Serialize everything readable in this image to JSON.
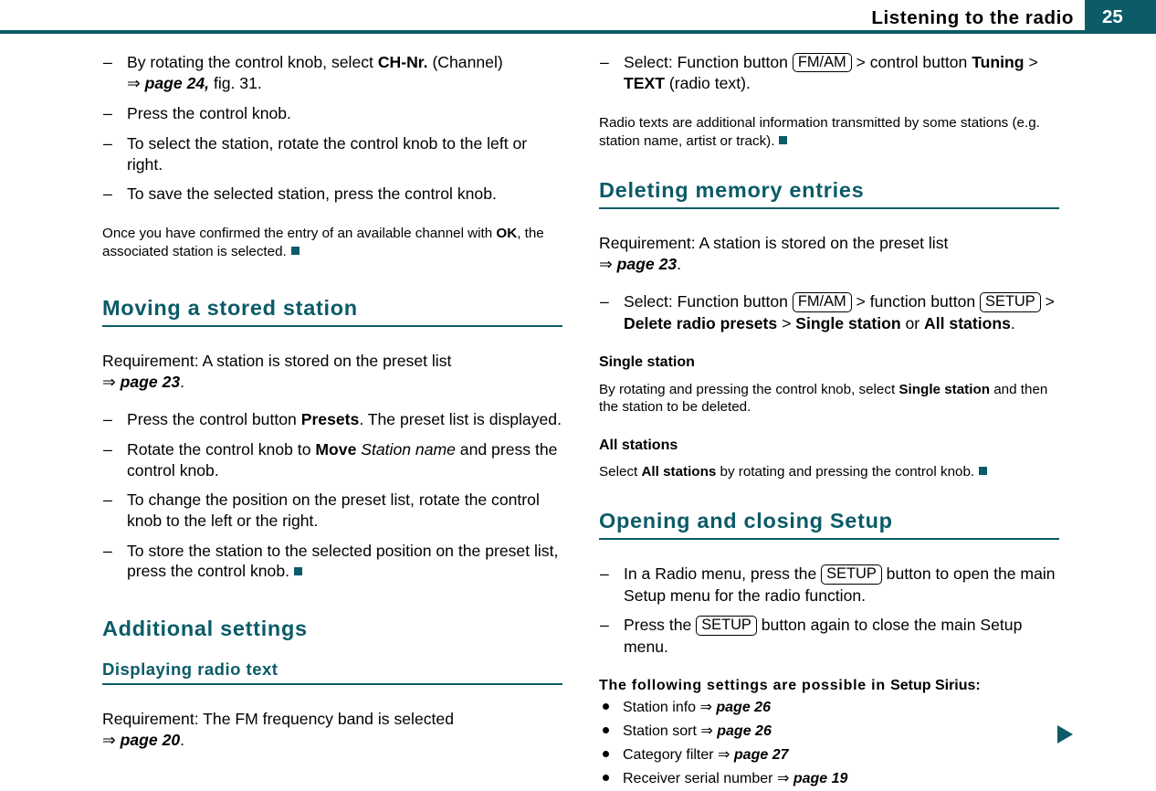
{
  "header": {
    "title": "Listening to the radio",
    "page_number": "25",
    "accent_color": "#0b5b68"
  },
  "arrow_glyph": "⇒",
  "continue_arrow_name": "continue-arrow",
  "left_column": {
    "steps_1": [
      {
        "prefix": "By rotating the control knob, select ",
        "bold": "CH-Nr.",
        "middle": " (Channel)",
        "ref_arrow": "⇒",
        "ref": "page 24,",
        "suffix": " fig. 31."
      },
      {
        "text": "Press the control knob."
      },
      {
        "text": "To select the station, rotate the control knob to the left or right."
      },
      {
        "text": "To save the selected station, press the control knob."
      }
    ],
    "note_1": {
      "prefix": "Once you have confirmed the entry of an available channel with ",
      "bold": "OK",
      "suffix": ", the associated station is selected."
    },
    "heading_moving": "Moving a stored station",
    "requirement_moving": {
      "text": "Requirement: A station is stored on the preset list",
      "ref_arrow": "⇒",
      "ref": "page 23",
      "suffix": "."
    },
    "steps_2": [
      {
        "prefix": "Press the control button ",
        "bold": "Presets",
        "suffix": ". The preset list is displayed."
      },
      {
        "prefix": "Rotate the control knob to ",
        "bold": "Move",
        "italic": " Station name",
        "suffix": " and press the control knob."
      },
      {
        "text": "To change the position on the preset list, rotate the control knob to the left or the right."
      },
      {
        "text": "To store the station to the selected position on the preset list, press the control knob.",
        "end_square": true
      }
    ],
    "heading_additional": "Additional settings",
    "heading_displaying": "Displaying radio text",
    "requirement_displaying": {
      "text": "Requirement: The FM frequency band is selected",
      "ref_arrow": "⇒",
      "ref": "page 20",
      "suffix": "."
    }
  },
  "right_column": {
    "step_radiotext": {
      "prefix": "Select: Function button ",
      "key1": "FM/AM",
      "middle": " > control button ",
      "bold1": "Tuning",
      "middle2": " > ",
      "bold2": "TEXT",
      "suffix": " (radio text)."
    },
    "note_radiotext": {
      "text": "Radio texts are additional information transmitted by some stations (e.g. station name, artist or track)."
    },
    "heading_deleting": "Deleting memory entries",
    "requirement_deleting": {
      "text": "Requirement: A station is stored on the preset list",
      "ref_arrow": "⇒",
      "ref": "page 23",
      "suffix": "."
    },
    "step_deleting": {
      "prefix": "Select: Function button ",
      "key1": "FM/AM",
      "middle": " > function button ",
      "key2": "SETUP",
      "middle2": " > ",
      "bold1": "Delete radio presets",
      "middle3": " > ",
      "bold2": "Single station",
      "middle4": " or ",
      "bold3": "All stations",
      "suffix": "."
    },
    "heading_single_station": "Single station",
    "text_single_station": {
      "prefix": "By rotating and pressing the control knob, select ",
      "bold": "Single station",
      "suffix": " and then the station to be deleted."
    },
    "heading_all_stations": "All stations",
    "text_all_stations": {
      "prefix": "Select ",
      "bold": "All stations",
      "suffix": " by rotating and pressing the control knob."
    },
    "heading_setup": "Opening and closing Setup",
    "steps_setup": [
      {
        "prefix": "In a Radio menu, press the ",
        "key": "SETUP",
        "suffix": " button to open the main Setup menu for the radio function."
      },
      {
        "prefix": "Press the ",
        "key": "SETUP",
        "suffix": " button again to close the main Setup menu."
      }
    ],
    "settings_intro": {
      "lead": "The following settings are possible in ",
      "menu": "Setup Sirius",
      "colon": ":"
    },
    "settings_items": [
      {
        "label": "Station info",
        "ref_arrow": "⇒",
        "ref": "page 26"
      },
      {
        "label": "Station sort",
        "ref_arrow": "⇒",
        "ref": "page 26"
      },
      {
        "label": "Category filter",
        "ref_arrow": "⇒",
        "ref": "page 27"
      },
      {
        "label": "Receiver serial number",
        "ref_arrow": "⇒",
        "ref": "page 19"
      }
    ]
  }
}
